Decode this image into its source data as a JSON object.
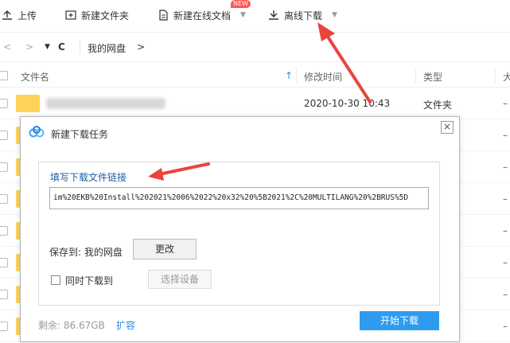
{
  "toolbar": {
    "upload": "上传",
    "new_folder": "新建文件夹",
    "new_online_doc": "新建在线文档",
    "new_badge": "NEW",
    "offline_download": "离线下载"
  },
  "nav": {
    "refresh": "C",
    "crumb": "我的网盘",
    "sep": ">"
  },
  "columns": {
    "name": "文件名",
    "modified": "修改时间",
    "type": "类型",
    "size": "大"
  },
  "rows": [
    {
      "modified": "2020-10-30 10:43",
      "type": "文件夹",
      "size": "–"
    },
    {
      "size": "–"
    },
    {
      "size": "–"
    },
    {
      "size": "–"
    },
    {
      "size": "–"
    },
    {
      "size": "–"
    },
    {
      "size": "–"
    },
    {
      "size": "–"
    }
  ],
  "dialog": {
    "title": "新建下载任务",
    "close": "×",
    "link_label": "填写下载文件链接",
    "url_value": "im%20EKB%20Install%202021%2006%2022%20x32%20%5B2021%2C%20MULTILANG%20%2BRUS%5D",
    "save_to": "保存到: 我的网盘",
    "change_button": "更改",
    "simultaneous_label": "同时下载到",
    "select_device": "选择设备",
    "free_space": "剩余: 86.67GB",
    "expand": "扩容",
    "start_button": "开始下载"
  },
  "colors": {
    "accent": "#2d9cf0",
    "link": "#1e5ea8",
    "arrow": "#e8453c",
    "folder": "#ffd25a"
  }
}
